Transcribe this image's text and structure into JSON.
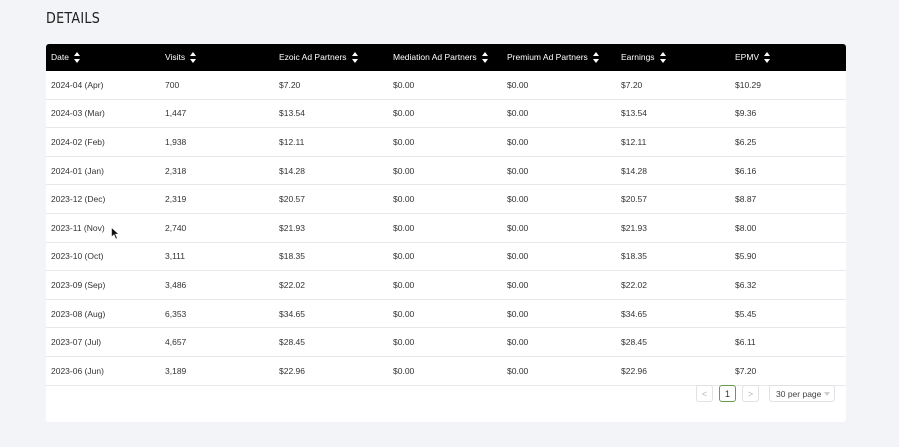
{
  "page": {
    "title": "DETAILS"
  },
  "table": {
    "columns": [
      "Date",
      "Visits",
      "Ezoic Ad Partners",
      "Mediation Ad Partners",
      "Premium Ad Partners",
      "Earnings",
      "EPMV"
    ],
    "rows": [
      [
        "2024-04 (Apr)",
        "700",
        "$7.20",
        "$0.00",
        "$0.00",
        "$7.20",
        "$10.29"
      ],
      [
        "2024-03 (Mar)",
        "1,447",
        "$13.54",
        "$0.00",
        "$0.00",
        "$13.54",
        "$9.36"
      ],
      [
        "2024-02 (Feb)",
        "1,938",
        "$12.11",
        "$0.00",
        "$0.00",
        "$12.11",
        "$6.25"
      ],
      [
        "2024-01 (Jan)",
        "2,318",
        "$14.28",
        "$0.00",
        "$0.00",
        "$14.28",
        "$6.16"
      ],
      [
        "2023-12 (Dec)",
        "2,319",
        "$20.57",
        "$0.00",
        "$0.00",
        "$20.57",
        "$8.87"
      ],
      [
        "2023-11 (Nov)",
        "2,740",
        "$21.93",
        "$0.00",
        "$0.00",
        "$21.93",
        "$8.00"
      ],
      [
        "2023-10 (Oct)",
        "3,111",
        "$18.35",
        "$0.00",
        "$0.00",
        "$18.35",
        "$5.90"
      ],
      [
        "2023-09 (Sep)",
        "3,486",
        "$22.02",
        "$0.00",
        "$0.00",
        "$22.02",
        "$6.32"
      ],
      [
        "2023-08 (Aug)",
        "6,353",
        "$34.65",
        "$0.00",
        "$0.00",
        "$34.65",
        "$5.45"
      ],
      [
        "2023-07 (Jul)",
        "4,657",
        "$28.45",
        "$0.00",
        "$0.00",
        "$28.45",
        "$6.11"
      ],
      [
        "2023-06 (Jun)",
        "3,189",
        "$22.96",
        "$0.00",
        "$0.00",
        "$22.96",
        "$7.20"
      ]
    ]
  },
  "pagination": {
    "prev_icon": "<",
    "current_page": "1",
    "next_icon": ">",
    "per_page": "30 per page"
  },
  "colors": {
    "header_bg": "#000000",
    "active_page_border": "#6a9a4e",
    "page_bg": "#f3f4f7"
  }
}
